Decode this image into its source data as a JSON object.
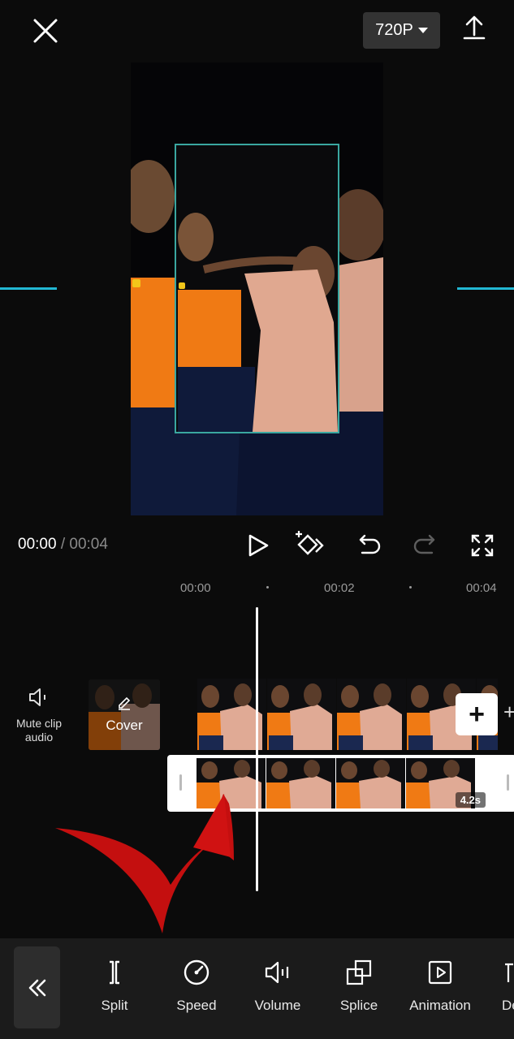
{
  "top_bar": {
    "resolution": "720P"
  },
  "playback": {
    "current_time": "00:00",
    "separator": " / ",
    "total_time": "00:04"
  },
  "ruler": {
    "t0": "00:00",
    "t1": "00:02",
    "t2": "00:04"
  },
  "tracks": {
    "mute_label": "Mute clip audio",
    "cover_label": "Cover",
    "duration_badge": "4.2s",
    "add_label": "+"
  },
  "toolbar": {
    "items": [
      {
        "label": "Split",
        "icon": "split-icon"
      },
      {
        "label": "Speed",
        "icon": "speed-icon"
      },
      {
        "label": "Volume",
        "icon": "volume-icon"
      },
      {
        "label": "Splice",
        "icon": "splice-icon"
      },
      {
        "label": "Animation",
        "icon": "animation-icon"
      },
      {
        "label": "De",
        "icon": "delete-icon"
      }
    ]
  },
  "colors": {
    "accent_guides": "#22b8d4",
    "annotation_arrow": "#c40f0f",
    "shirt_orange": "#f07a14",
    "shirt_peach": "#e0a890"
  }
}
